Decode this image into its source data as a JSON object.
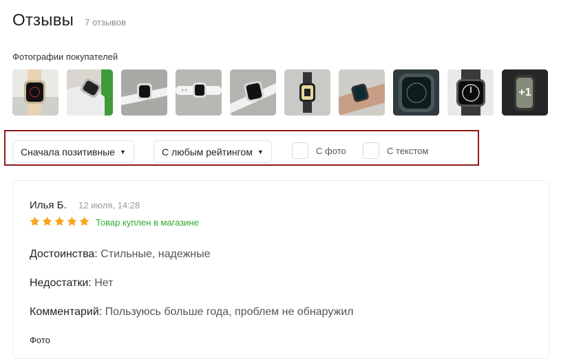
{
  "header": {
    "title": "Отзывы",
    "count": "7 отзывов"
  },
  "photos": {
    "label": "Фотографии покупателей",
    "items": [
      {
        "icon": "photo-watch-wrist-icon"
      },
      {
        "icon": "photo-watch-hand-icon"
      },
      {
        "icon": "photo-watch-table-icon"
      },
      {
        "icon": "photo-watch-flat-icon"
      },
      {
        "icon": "photo-watch-angle-icon"
      },
      {
        "icon": "photo-watch-box-icon"
      },
      {
        "icon": "photo-watch-arm-icon"
      },
      {
        "icon": "photo-watch-closeup-icon"
      },
      {
        "icon": "photo-watch-steel-icon"
      },
      {
        "icon": "photo-watch-dark-icon"
      }
    ],
    "more": "+1"
  },
  "filters": {
    "sort": "Сначала позитивные",
    "rating": "С любым рейтингом",
    "with_photo": "С фото",
    "with_text": "С текстом"
  },
  "review": {
    "author": "Илья Б.",
    "date": "12 июля, 14:28",
    "rating": 5,
    "bought_label": "Товар куплен в магазине",
    "pros_label": "Достоинства:",
    "pros": " Стильные, надежные",
    "cons_label": "Недостатки:",
    "cons": " Нет",
    "comment_label": "Комментарий:",
    "comment": " Пользуюсь больше года, проблем не обнаружил",
    "photo_label": "Фото"
  },
  "colors": {
    "star": "#f5a623",
    "bought": "#2ea82e",
    "highlight_border": "#8b1a1a"
  }
}
